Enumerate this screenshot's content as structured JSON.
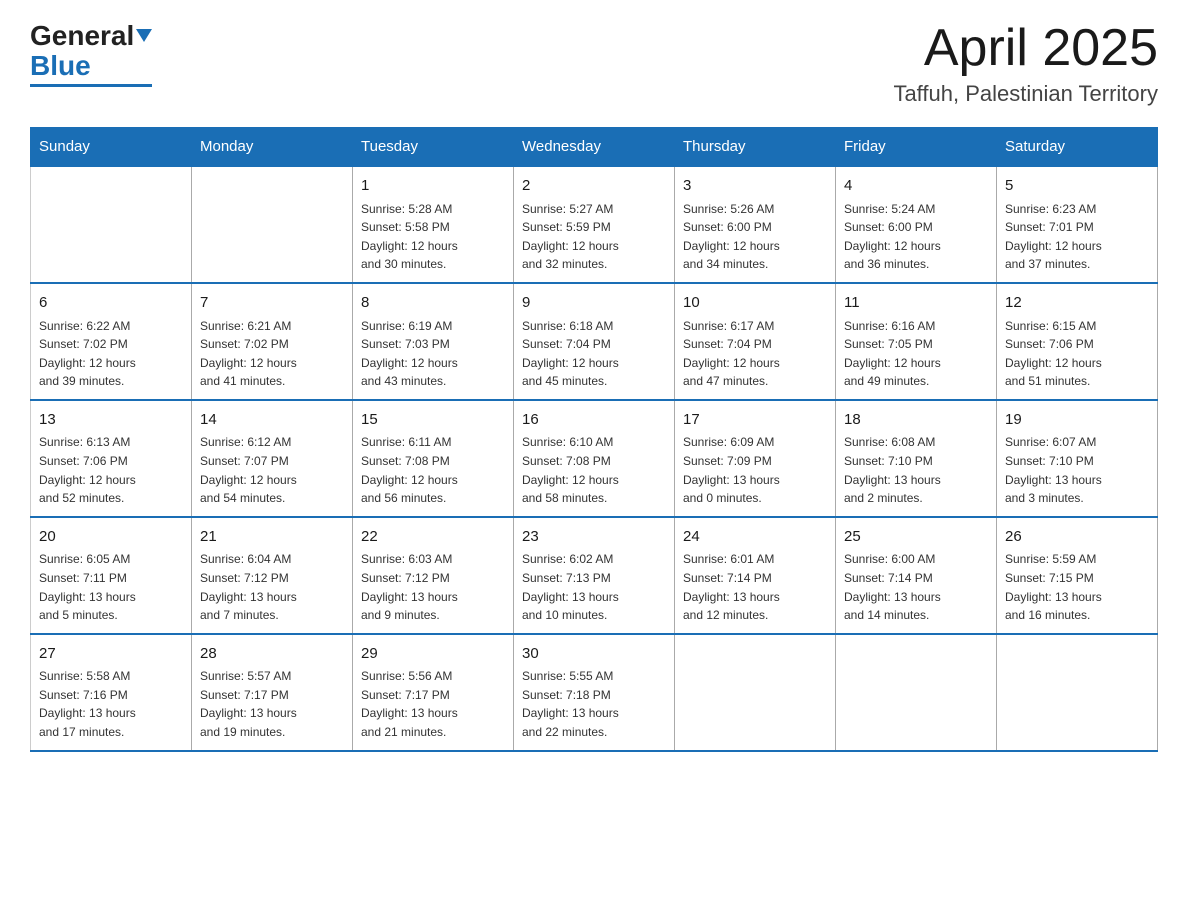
{
  "header": {
    "logo": {
      "line1": "General",
      "line2": "Blue"
    },
    "title": "April 2025",
    "subtitle": "Taffuh, Palestinian Territory"
  },
  "weekdays": [
    "Sunday",
    "Monday",
    "Tuesday",
    "Wednesday",
    "Thursday",
    "Friday",
    "Saturday"
  ],
  "weeks": [
    [
      {
        "day": "",
        "info": ""
      },
      {
        "day": "",
        "info": ""
      },
      {
        "day": "1",
        "info": "Sunrise: 5:28 AM\nSunset: 5:58 PM\nDaylight: 12 hours\nand 30 minutes."
      },
      {
        "day": "2",
        "info": "Sunrise: 5:27 AM\nSunset: 5:59 PM\nDaylight: 12 hours\nand 32 minutes."
      },
      {
        "day": "3",
        "info": "Sunrise: 5:26 AM\nSunset: 6:00 PM\nDaylight: 12 hours\nand 34 minutes."
      },
      {
        "day": "4",
        "info": "Sunrise: 5:24 AM\nSunset: 6:00 PM\nDaylight: 12 hours\nand 36 minutes."
      },
      {
        "day": "5",
        "info": "Sunrise: 6:23 AM\nSunset: 7:01 PM\nDaylight: 12 hours\nand 37 minutes."
      }
    ],
    [
      {
        "day": "6",
        "info": "Sunrise: 6:22 AM\nSunset: 7:02 PM\nDaylight: 12 hours\nand 39 minutes."
      },
      {
        "day": "7",
        "info": "Sunrise: 6:21 AM\nSunset: 7:02 PM\nDaylight: 12 hours\nand 41 minutes."
      },
      {
        "day": "8",
        "info": "Sunrise: 6:19 AM\nSunset: 7:03 PM\nDaylight: 12 hours\nand 43 minutes."
      },
      {
        "day": "9",
        "info": "Sunrise: 6:18 AM\nSunset: 7:04 PM\nDaylight: 12 hours\nand 45 minutes."
      },
      {
        "day": "10",
        "info": "Sunrise: 6:17 AM\nSunset: 7:04 PM\nDaylight: 12 hours\nand 47 minutes."
      },
      {
        "day": "11",
        "info": "Sunrise: 6:16 AM\nSunset: 7:05 PM\nDaylight: 12 hours\nand 49 minutes."
      },
      {
        "day": "12",
        "info": "Sunrise: 6:15 AM\nSunset: 7:06 PM\nDaylight: 12 hours\nand 51 minutes."
      }
    ],
    [
      {
        "day": "13",
        "info": "Sunrise: 6:13 AM\nSunset: 7:06 PM\nDaylight: 12 hours\nand 52 minutes."
      },
      {
        "day": "14",
        "info": "Sunrise: 6:12 AM\nSunset: 7:07 PM\nDaylight: 12 hours\nand 54 minutes."
      },
      {
        "day": "15",
        "info": "Sunrise: 6:11 AM\nSunset: 7:08 PM\nDaylight: 12 hours\nand 56 minutes."
      },
      {
        "day": "16",
        "info": "Sunrise: 6:10 AM\nSunset: 7:08 PM\nDaylight: 12 hours\nand 58 minutes."
      },
      {
        "day": "17",
        "info": "Sunrise: 6:09 AM\nSunset: 7:09 PM\nDaylight: 13 hours\nand 0 minutes."
      },
      {
        "day": "18",
        "info": "Sunrise: 6:08 AM\nSunset: 7:10 PM\nDaylight: 13 hours\nand 2 minutes."
      },
      {
        "day": "19",
        "info": "Sunrise: 6:07 AM\nSunset: 7:10 PM\nDaylight: 13 hours\nand 3 minutes."
      }
    ],
    [
      {
        "day": "20",
        "info": "Sunrise: 6:05 AM\nSunset: 7:11 PM\nDaylight: 13 hours\nand 5 minutes."
      },
      {
        "day": "21",
        "info": "Sunrise: 6:04 AM\nSunset: 7:12 PM\nDaylight: 13 hours\nand 7 minutes."
      },
      {
        "day": "22",
        "info": "Sunrise: 6:03 AM\nSunset: 7:12 PM\nDaylight: 13 hours\nand 9 minutes."
      },
      {
        "day": "23",
        "info": "Sunrise: 6:02 AM\nSunset: 7:13 PM\nDaylight: 13 hours\nand 10 minutes."
      },
      {
        "day": "24",
        "info": "Sunrise: 6:01 AM\nSunset: 7:14 PM\nDaylight: 13 hours\nand 12 minutes."
      },
      {
        "day": "25",
        "info": "Sunrise: 6:00 AM\nSunset: 7:14 PM\nDaylight: 13 hours\nand 14 minutes."
      },
      {
        "day": "26",
        "info": "Sunrise: 5:59 AM\nSunset: 7:15 PM\nDaylight: 13 hours\nand 16 minutes."
      }
    ],
    [
      {
        "day": "27",
        "info": "Sunrise: 5:58 AM\nSunset: 7:16 PM\nDaylight: 13 hours\nand 17 minutes."
      },
      {
        "day": "28",
        "info": "Sunrise: 5:57 AM\nSunset: 7:17 PM\nDaylight: 13 hours\nand 19 minutes."
      },
      {
        "day": "29",
        "info": "Sunrise: 5:56 AM\nSunset: 7:17 PM\nDaylight: 13 hours\nand 21 minutes."
      },
      {
        "day": "30",
        "info": "Sunrise: 5:55 AM\nSunset: 7:18 PM\nDaylight: 13 hours\nand 22 minutes."
      },
      {
        "day": "",
        "info": ""
      },
      {
        "day": "",
        "info": ""
      },
      {
        "day": "",
        "info": ""
      }
    ]
  ]
}
